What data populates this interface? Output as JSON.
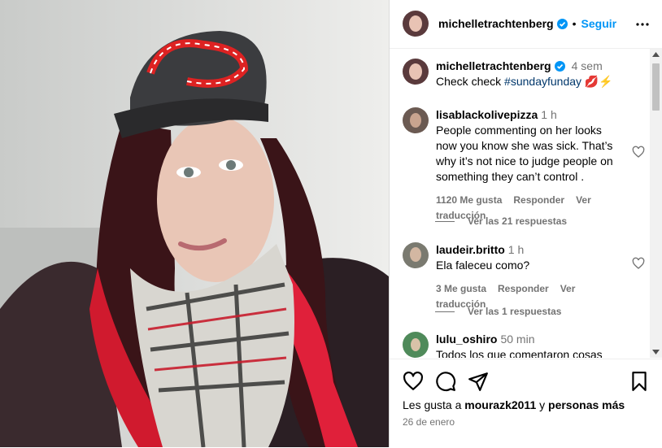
{
  "post": {
    "username": "michelletrachtenberg",
    "follow_label": "Seguir",
    "caption_time": "4 sem",
    "caption_text": "Check check ",
    "caption_hashtag": "#sundayfunday",
    "caption_emoji": "💋⚡"
  },
  "comments": [
    {
      "username": "lisablackolivepizza",
      "time": "1 h",
      "text": "People commenting on her looks now you know she was sick. That’s why it’s not nice to judge people on something they can’t control .",
      "likes": "1120 Me gusta",
      "reply_label": "Responder",
      "translate_label": "Ver traducción",
      "replies_label": "Ver las 21 respuestas"
    },
    {
      "username": "laudeir.britto",
      "time": "1 h",
      "text": "Ela faleceu como?",
      "likes": "3 Me gusta",
      "reply_label": "Responder",
      "translate_label": "Ver traducción",
      "replies_label": "Ver las 1 respuestas"
    },
    {
      "username": "lulu_oshiro",
      "time": "50 min",
      "text": "Todos los que comentaron cosas"
    }
  ],
  "footer": {
    "likes_prefix": "Les gusta a ",
    "likes_user": "mourazk2011",
    "likes_mid": " y ",
    "likes_suffix": "personas más",
    "date": "26 de enero"
  },
  "icons": {
    "like": "heart-icon",
    "comment": "comment-icon",
    "share": "share-icon",
    "save": "bookmark-icon",
    "more": "more-icon",
    "verified": "verified-badge-icon"
  },
  "colors": {
    "accent": "#0095f6",
    "hashtag": "#00376b",
    "secondary_text": "#737373",
    "verified": "#0095f6"
  }
}
